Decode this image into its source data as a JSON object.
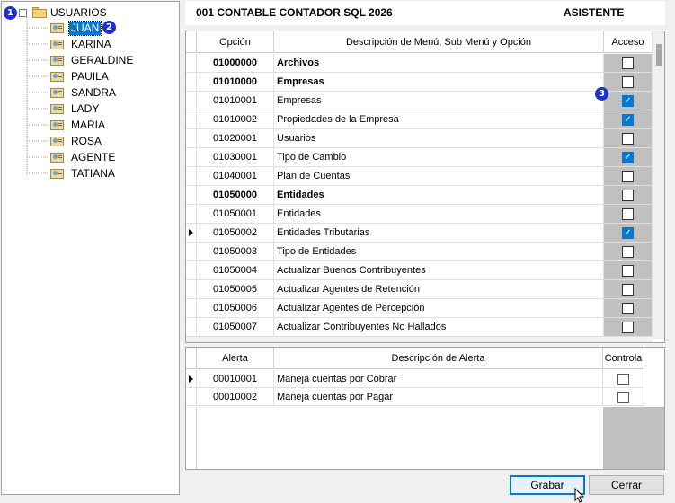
{
  "tree": {
    "root_label": "USUARIOS",
    "badge1": "1",
    "badge2": "2",
    "users": [
      "JUAN",
      "KARINA",
      "GERALDINE",
      "PAUILA",
      "SANDRA",
      "LADY",
      "MARIA",
      "ROSA",
      "AGENTE",
      "TATIANA"
    ]
  },
  "header": {
    "company": "001 CONTABLE CONTADOR SQL 2026",
    "role": "ASISTENTE"
  },
  "menu_grid": {
    "col_option": "Opción",
    "col_description": "Descripción de Menú, Sub Menú y Opción",
    "col_access": "Acceso",
    "badge3": "3",
    "rows": [
      {
        "code": "01000000",
        "desc": "Archivos",
        "bold": true,
        "access": false
      },
      {
        "code": "01010000",
        "desc": "Empresas",
        "bold": true,
        "access": false
      },
      {
        "code": "01010001",
        "desc": "Empresas",
        "bold": false,
        "access": true
      },
      {
        "code": "01010002",
        "desc": "Propiedades de la Empresa",
        "bold": false,
        "access": true
      },
      {
        "code": "01020001",
        "desc": "Usuarios",
        "bold": false,
        "access": false
      },
      {
        "code": "01030001",
        "desc": "Tipo de Cambio",
        "bold": false,
        "access": true
      },
      {
        "code": "01040001",
        "desc": "Plan de Cuentas",
        "bold": false,
        "access": false
      },
      {
        "code": "01050000",
        "desc": "Entidades",
        "bold": true,
        "access": false
      },
      {
        "code": "01050001",
        "desc": "Entidades",
        "bold": false,
        "access": false
      },
      {
        "code": "01050002",
        "desc": "Entidades Tributarias",
        "bold": false,
        "access": true,
        "current": true
      },
      {
        "code": "01050003",
        "desc": "Tipo de Entidades",
        "bold": false,
        "access": false
      },
      {
        "code": "01050004",
        "desc": "Actualizar Buenos Contribuyentes",
        "bold": false,
        "access": false
      },
      {
        "code": "01050005",
        "desc": "Actualizar Agentes de Retención",
        "bold": false,
        "access": false
      },
      {
        "code": "01050006",
        "desc": "Actualizar Agentes de Percepción",
        "bold": false,
        "access": false
      },
      {
        "code": "01050007",
        "desc": "Actualizar Contribuyentes No Hallados",
        "bold": false,
        "access": false
      }
    ]
  },
  "alert_grid": {
    "col_alert": "Alerta",
    "col_description": "Descripción de Alerta",
    "col_control": "Controla",
    "rows": [
      {
        "code": "00010001",
        "desc": "Maneja cuentas por Cobrar",
        "control": false,
        "current": true
      },
      {
        "code": "00010002",
        "desc": "Maneja cuentas por Pagar",
        "control": false
      }
    ]
  },
  "buttons": {
    "save": "Grabar",
    "close": "Cerrar"
  }
}
